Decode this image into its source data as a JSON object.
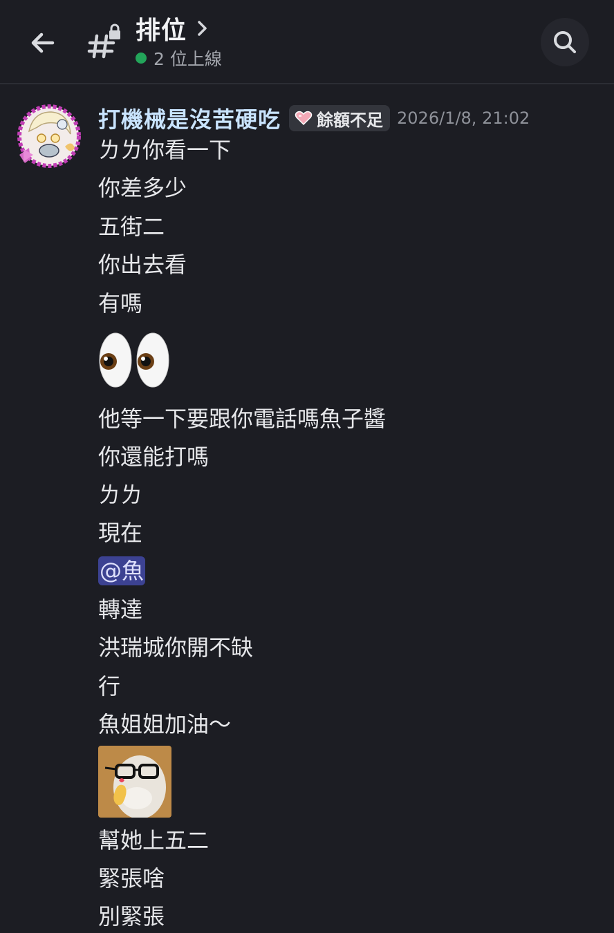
{
  "header": {
    "channel_name": "排位",
    "online_text": "2 位上線",
    "back_icon": "back-arrow-icon",
    "channel_icon": "locked-channel-hash-icon",
    "search_icon": "search-icon",
    "online_color": "#23a55a"
  },
  "message": {
    "author": "打機械是沒苦硬吃",
    "role_tag": "餘額不足",
    "timestamp": "2026/1/8, 21:02",
    "author_color": "#c9e4ff",
    "lines": {
      "l1": "ㄌㄌ你看一下",
      "l2": "你差多少",
      "l3": "五街二",
      "l4": "你出去看",
      "l5": "有嗎",
      "l6": "他等一下要跟你電話嗎魚子醬",
      "l7": "你還能打嗎",
      "l8": "ㄌㄌ",
      "l9": "現在",
      "l10_mention": "@魚",
      "l11": "轉達",
      "l12": "洪瑞城你開不缺",
      "l13": "行",
      "l14": "魚姐姐加油～",
      "l15": "幫她上五二",
      "l16": "緊張啥",
      "l17": "別緊張"
    },
    "emoji_icon": "eyes-emoji-icon",
    "sticker_icon": "cat-glasses-heart-sticker-icon",
    "mention_color": "#3c4292"
  }
}
